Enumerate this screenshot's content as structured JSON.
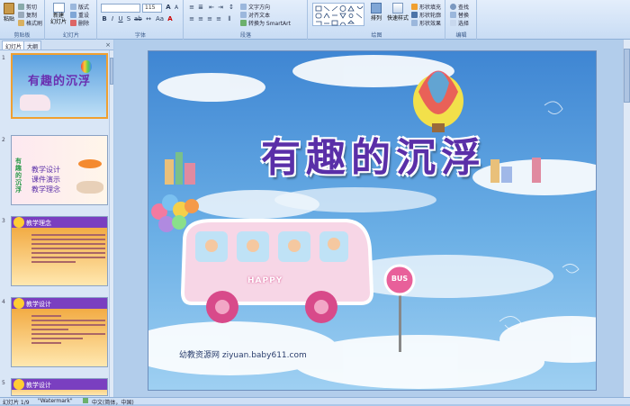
{
  "ribbon": {
    "clipboard": {
      "paste": "粘贴",
      "cut": "剪切",
      "copy": "复制",
      "format_painter": "格式刷",
      "label": "剪贴板"
    },
    "slides": {
      "new_slide": "新建\n幻灯片",
      "layout": "版式",
      "reset": "重设",
      "delete": "删除",
      "label": "幻灯片"
    },
    "font": {
      "font_name": "",
      "font_size": "115",
      "label": "字体"
    },
    "paragraph": {
      "text_direction": "文字方向",
      "align_text": "对齐文本",
      "convert_smartart": "转换为 SmartArt",
      "label": "段落"
    },
    "drawing": {
      "arrange": "排列",
      "quick_styles": "快速样式",
      "shape_fill": "形状填充",
      "shape_outline": "形状轮廓",
      "shape_effects": "形状效果",
      "label": "绘图"
    },
    "editing": {
      "find": "查找",
      "replace": "替换",
      "select": "选择",
      "label": "编辑"
    }
  },
  "left_panel": {
    "tabs": [
      "幻灯片",
      "大纲"
    ],
    "slides": [
      {
        "num": "1",
        "title": "有趣的沉浮"
      },
      {
        "num": "2",
        "vertical": "有趣的沉浮",
        "lines": [
          "教学设计",
          "课件演示",
          "教学理念"
        ]
      },
      {
        "num": "3",
        "title": "教学理念"
      },
      {
        "num": "4",
        "title": "教学设计"
      },
      {
        "num": "5",
        "title": "教学设计"
      }
    ]
  },
  "slide": {
    "title": "有趣的沉浮",
    "bus_text": "HAPPY",
    "sign_text": "BUS",
    "watermark": "幼教资源网 ziyuan.baby611.com"
  },
  "status": {
    "slide_info": "幻灯片 1/9",
    "theme": "\"Watermark\"",
    "language": "中文(简体，中国)"
  },
  "colors": {
    "title_purple": "#5a2fa8",
    "sky_blue": "#4a8fd6",
    "bus_pink": "#f7d6e6"
  }
}
